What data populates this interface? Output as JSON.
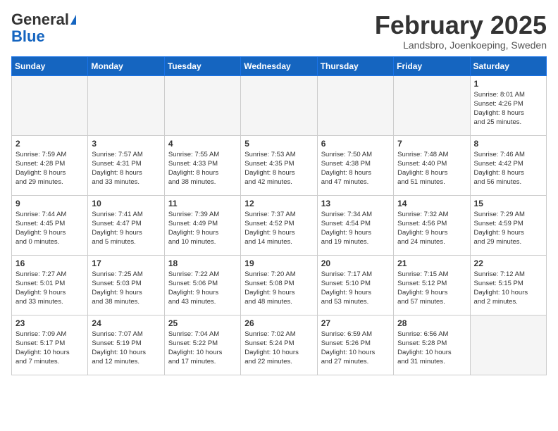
{
  "header": {
    "logo_general": "General",
    "logo_blue": "Blue",
    "title": "February 2025",
    "subtitle": "Landsbro, Joenkoeping, Sweden"
  },
  "days_of_week": [
    "Sunday",
    "Monday",
    "Tuesday",
    "Wednesday",
    "Thursday",
    "Friday",
    "Saturday"
  ],
  "weeks": [
    [
      {
        "day": "",
        "info": ""
      },
      {
        "day": "",
        "info": ""
      },
      {
        "day": "",
        "info": ""
      },
      {
        "day": "",
        "info": ""
      },
      {
        "day": "",
        "info": ""
      },
      {
        "day": "",
        "info": ""
      },
      {
        "day": "1",
        "info": "Sunrise: 8:01 AM\nSunset: 4:26 PM\nDaylight: 8 hours\nand 25 minutes."
      }
    ],
    [
      {
        "day": "2",
        "info": "Sunrise: 7:59 AM\nSunset: 4:28 PM\nDaylight: 8 hours\nand 29 minutes."
      },
      {
        "day": "3",
        "info": "Sunrise: 7:57 AM\nSunset: 4:31 PM\nDaylight: 8 hours\nand 33 minutes."
      },
      {
        "day": "4",
        "info": "Sunrise: 7:55 AM\nSunset: 4:33 PM\nDaylight: 8 hours\nand 38 minutes."
      },
      {
        "day": "5",
        "info": "Sunrise: 7:53 AM\nSunset: 4:35 PM\nDaylight: 8 hours\nand 42 minutes."
      },
      {
        "day": "6",
        "info": "Sunrise: 7:50 AM\nSunset: 4:38 PM\nDaylight: 8 hours\nand 47 minutes."
      },
      {
        "day": "7",
        "info": "Sunrise: 7:48 AM\nSunset: 4:40 PM\nDaylight: 8 hours\nand 51 minutes."
      },
      {
        "day": "8",
        "info": "Sunrise: 7:46 AM\nSunset: 4:42 PM\nDaylight: 8 hours\nand 56 minutes."
      }
    ],
    [
      {
        "day": "9",
        "info": "Sunrise: 7:44 AM\nSunset: 4:45 PM\nDaylight: 9 hours\nand 0 minutes."
      },
      {
        "day": "10",
        "info": "Sunrise: 7:41 AM\nSunset: 4:47 PM\nDaylight: 9 hours\nand 5 minutes."
      },
      {
        "day": "11",
        "info": "Sunrise: 7:39 AM\nSunset: 4:49 PM\nDaylight: 9 hours\nand 10 minutes."
      },
      {
        "day": "12",
        "info": "Sunrise: 7:37 AM\nSunset: 4:52 PM\nDaylight: 9 hours\nand 14 minutes."
      },
      {
        "day": "13",
        "info": "Sunrise: 7:34 AM\nSunset: 4:54 PM\nDaylight: 9 hours\nand 19 minutes."
      },
      {
        "day": "14",
        "info": "Sunrise: 7:32 AM\nSunset: 4:56 PM\nDaylight: 9 hours\nand 24 minutes."
      },
      {
        "day": "15",
        "info": "Sunrise: 7:29 AM\nSunset: 4:59 PM\nDaylight: 9 hours\nand 29 minutes."
      }
    ],
    [
      {
        "day": "16",
        "info": "Sunrise: 7:27 AM\nSunset: 5:01 PM\nDaylight: 9 hours\nand 33 minutes."
      },
      {
        "day": "17",
        "info": "Sunrise: 7:25 AM\nSunset: 5:03 PM\nDaylight: 9 hours\nand 38 minutes."
      },
      {
        "day": "18",
        "info": "Sunrise: 7:22 AM\nSunset: 5:06 PM\nDaylight: 9 hours\nand 43 minutes."
      },
      {
        "day": "19",
        "info": "Sunrise: 7:20 AM\nSunset: 5:08 PM\nDaylight: 9 hours\nand 48 minutes."
      },
      {
        "day": "20",
        "info": "Sunrise: 7:17 AM\nSunset: 5:10 PM\nDaylight: 9 hours\nand 53 minutes."
      },
      {
        "day": "21",
        "info": "Sunrise: 7:15 AM\nSunset: 5:12 PM\nDaylight: 9 hours\nand 57 minutes."
      },
      {
        "day": "22",
        "info": "Sunrise: 7:12 AM\nSunset: 5:15 PM\nDaylight: 10 hours\nand 2 minutes."
      }
    ],
    [
      {
        "day": "23",
        "info": "Sunrise: 7:09 AM\nSunset: 5:17 PM\nDaylight: 10 hours\nand 7 minutes."
      },
      {
        "day": "24",
        "info": "Sunrise: 7:07 AM\nSunset: 5:19 PM\nDaylight: 10 hours\nand 12 minutes."
      },
      {
        "day": "25",
        "info": "Sunrise: 7:04 AM\nSunset: 5:22 PM\nDaylight: 10 hours\nand 17 minutes."
      },
      {
        "day": "26",
        "info": "Sunrise: 7:02 AM\nSunset: 5:24 PM\nDaylight: 10 hours\nand 22 minutes."
      },
      {
        "day": "27",
        "info": "Sunrise: 6:59 AM\nSunset: 5:26 PM\nDaylight: 10 hours\nand 27 minutes."
      },
      {
        "day": "28",
        "info": "Sunrise: 6:56 AM\nSunset: 5:28 PM\nDaylight: 10 hours\nand 31 minutes."
      },
      {
        "day": "",
        "info": ""
      }
    ]
  ]
}
